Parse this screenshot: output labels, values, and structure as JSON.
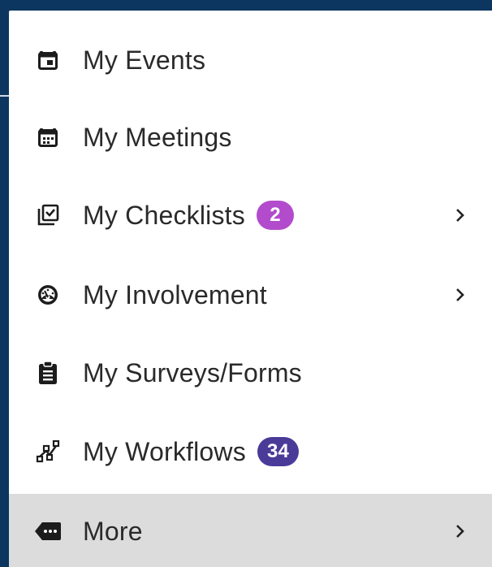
{
  "menu": {
    "items": [
      {
        "label": "My Events",
        "icon": "calendar-icon"
      },
      {
        "label": "My Meetings",
        "icon": "calendar-grid-icon"
      },
      {
        "label": "My Checklists",
        "icon": "checklist-icon",
        "badge": "2",
        "badge_color": "#b24bcc",
        "has_submenu": true
      },
      {
        "label": "My Involvement",
        "icon": "gauge-icon",
        "has_submenu": true
      },
      {
        "label": "My Surveys/Forms",
        "icon": "clipboard-icon"
      },
      {
        "label": "My Workflows",
        "icon": "workflow-icon",
        "badge": "34",
        "badge_color": "#4a3b99"
      },
      {
        "label": "More",
        "icon": "more-tag-icon",
        "has_submenu": true,
        "highlighted": true
      }
    ]
  },
  "colors": {
    "page_background": "#0c3660",
    "menu_background": "#ffffff",
    "highlight_background": "#dcdcdc",
    "text": "#2a2a2a"
  }
}
